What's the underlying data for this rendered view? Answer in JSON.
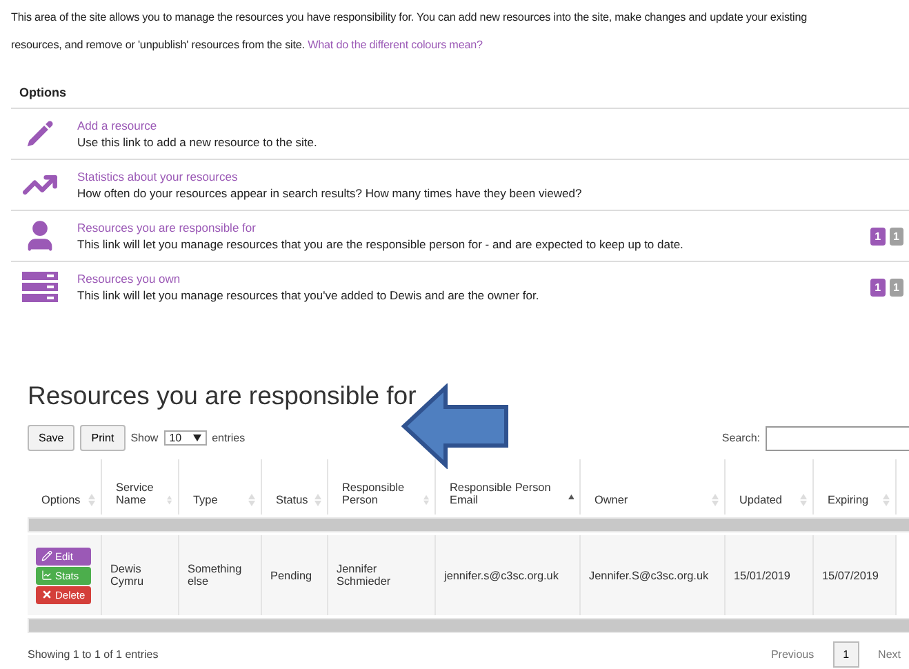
{
  "intro": {
    "lines": [
      "This area of the site allows you to manage the resources you have responsibility for. You can add new resources into the site, make changes and update your existing",
      "resources, and remove or 'unpublish' resources from the site."
    ],
    "link": "What do the different colours mean?"
  },
  "options": {
    "title": "Options",
    "items": [
      {
        "kind": "pencil",
        "title": "Add a resource",
        "description": "Use this link to add a new resource to the site."
      },
      {
        "kind": "chart",
        "title": "Statistics about your resources",
        "description": "How often do your resources appear in search results? How many times have they been viewed?"
      },
      {
        "kind": "person",
        "title": "Resources you are responsible for",
        "description": "This link will let you manage resources that you are the responsible person for - and are expected to keep up to date.",
        "badges": [
          {
            "text": "1",
            "color": "#9b59b6"
          },
          {
            "text": "1",
            "color": "#a0a0a0"
          }
        ]
      },
      {
        "kind": "list",
        "title": "Resources you own",
        "description": "This link will let you manage resources that you've added to Dewis and are the owner for.",
        "badges": [
          {
            "text": "1",
            "color": "#9b59b6"
          },
          {
            "text": "1",
            "color": "#a0a0a0"
          }
        ]
      }
    ]
  },
  "section_title": "Resources you are responsible for",
  "toolbar": {
    "buttons": [
      "Save",
      "Print"
    ],
    "show_label": "Show",
    "page_size": "10",
    "entries_label": "entries",
    "search_label": "Search:"
  },
  "table": {
    "columns": [
      {
        "label": "Options",
        "sorted": false
      },
      {
        "label": "Service Name",
        "sorted": false
      },
      {
        "label": "Type",
        "sorted": false
      },
      {
        "label": "Status",
        "sorted": false
      },
      {
        "label": "Responsible Person",
        "sorted": false
      },
      {
        "label": "Responsible Person Email",
        "sorted": true
      },
      {
        "label": "Owner",
        "sorted": false
      },
      {
        "label": "Updated",
        "sorted": false
      },
      {
        "label": "Expiring",
        "sorted": false
      }
    ],
    "rows": [
      {
        "cells": [
          {
            "actions": [
              {
                "kind": "edit",
                "label": "Edit"
              },
              {
                "kind": "stats",
                "label": "Stats"
              },
              {
                "kind": "delete",
                "label": "Delete"
              }
            ]
          },
          "Dewis Cymru",
          "Something else",
          "Pending",
          "Jennifer Schmieder",
          "jennifer.s@c3sc.org.uk",
          "Jennifer.S@c3sc.org.uk",
          "15/01/2019",
          "15/07/2019"
        ]
      }
    ]
  },
  "footer": {
    "info": "Showing 1 to 1 of 1 entries",
    "previous": "Previous",
    "pages": [
      {
        "label": "1",
        "selected": true
      }
    ],
    "next": "Next"
  }
}
